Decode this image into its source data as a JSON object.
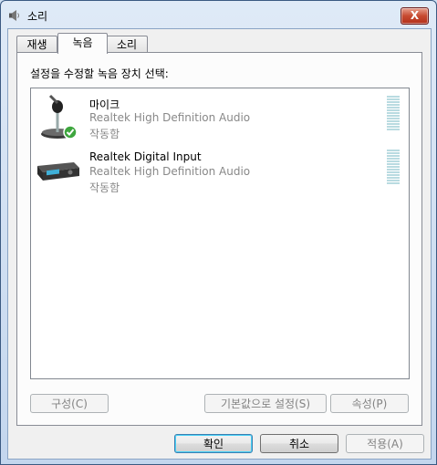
{
  "window": {
    "title": "소리",
    "close_glyph": "X",
    "icon": "speaker-icon"
  },
  "tabs": [
    {
      "label": "재생",
      "selected": false
    },
    {
      "label": "녹음",
      "selected": true
    },
    {
      "label": "소리",
      "selected": false
    }
  ],
  "recording": {
    "instruction": "설정을 수정할 녹음 장치 선택:",
    "devices": [
      {
        "name": "마이크",
        "description": "Realtek High Definition Audio",
        "status": "작동함",
        "icon": "microphone-icon",
        "default": true
      },
      {
        "name": "Realtek Digital Input",
        "description": "Realtek High Definition Audio",
        "status": "작동함",
        "icon": "digital-input-device-icon",
        "default": false
      }
    ],
    "configure_label": "구성(C)",
    "set_default_label": "기본값으로 설정(S)",
    "properties_label": "속성(P)"
  },
  "footer": {
    "ok_label": "확인",
    "cancel_label": "취소",
    "apply_label": "적용(A)"
  },
  "colors": {
    "meter": "#b9dbe1",
    "accent": "#3c7fb1",
    "check": "#3ea63e"
  }
}
